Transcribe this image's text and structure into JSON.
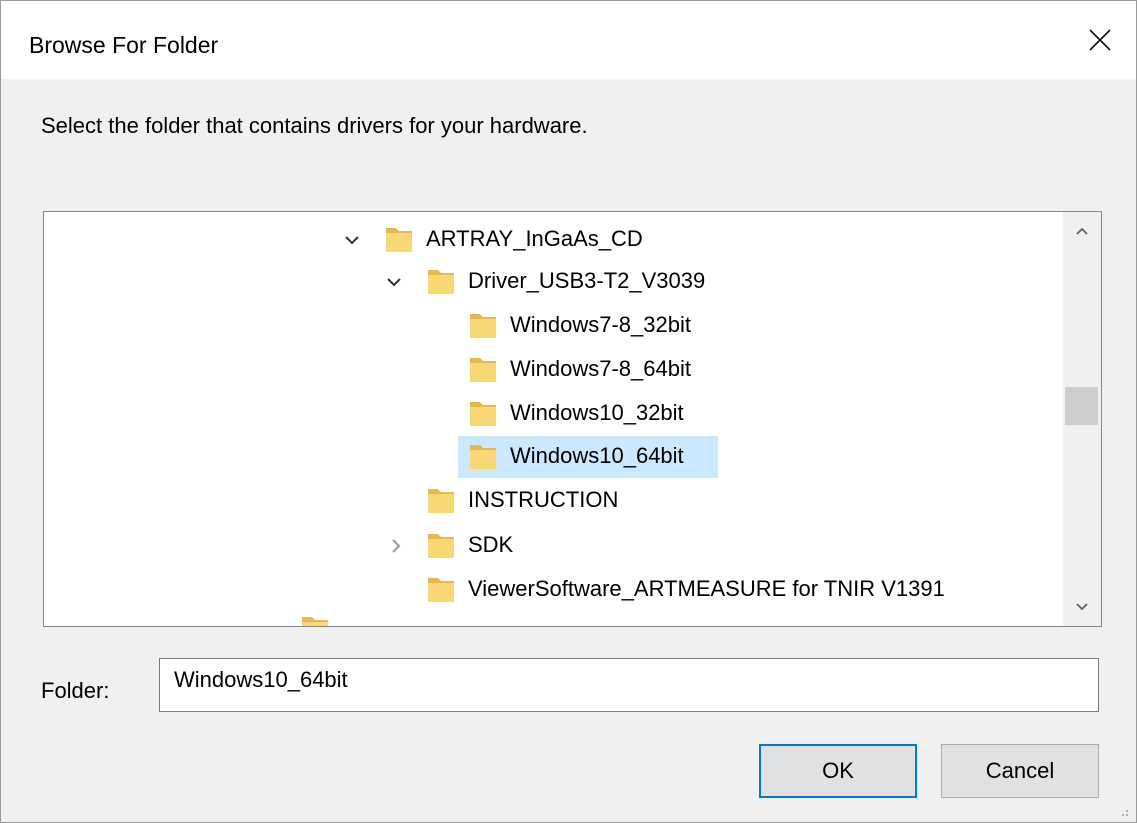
{
  "window": {
    "title": "Browse For Folder"
  },
  "instruction": "Select the folder that contains drivers for your hardware.",
  "tree": {
    "items": [
      {
        "label": "ARTRAY_InGaAs_CD",
        "expander": "expanded"
      },
      {
        "label": "Driver_USB3-T2_V3039",
        "expander": "expanded"
      },
      {
        "label": "Windows7-8_32bit",
        "expander": "none"
      },
      {
        "label": "Windows7-8_64bit",
        "expander": "none"
      },
      {
        "label": "Windows10_32bit",
        "expander": "none"
      },
      {
        "label": "Windows10_64bit",
        "expander": "none",
        "selected": true
      },
      {
        "label": "INSTRUCTION",
        "expander": "none"
      },
      {
        "label": "SDK",
        "expander": "collapsed"
      },
      {
        "label": "ViewerSoftware_ARTMEASURE for TNIR V1391",
        "expander": "none"
      }
    ]
  },
  "folder_field": {
    "label": "Folder:",
    "value": "Windows10_64bit"
  },
  "buttons": {
    "ok": "OK",
    "cancel": "Cancel"
  },
  "colors": {
    "selection": "#cce8ff",
    "accent": "#0078d7",
    "folder": "#f8d775"
  }
}
